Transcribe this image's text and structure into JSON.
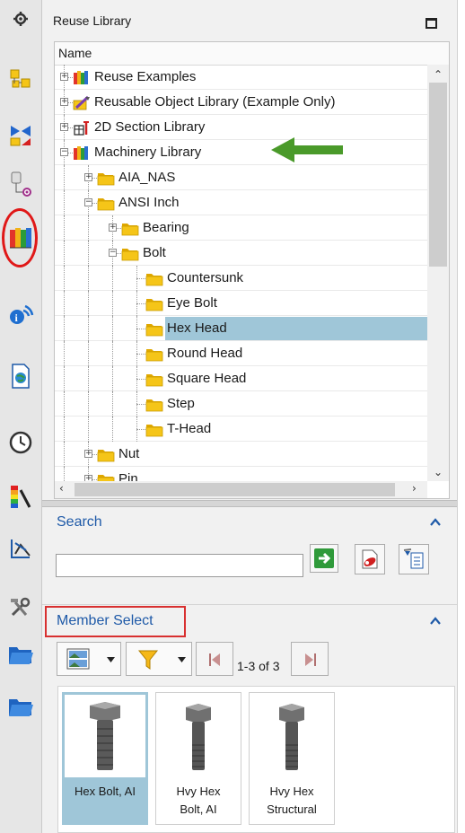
{
  "panel": {
    "title": "Reuse Library"
  },
  "tree": {
    "column_header": "Name",
    "rows": [
      {
        "label": "Reuse Examples",
        "icon": "library-books-icon"
      },
      {
        "label": "Reusable Object Library (Example Only)",
        "icon": "object-library-icon"
      },
      {
        "label": "2D Section Library",
        "icon": "section-library-icon"
      },
      {
        "label": "Machinery Library",
        "icon": "library-books-icon"
      },
      {
        "label": "AIA_NAS",
        "icon": "folder-icon"
      },
      {
        "label": "ANSI Inch",
        "icon": "folder-icon"
      },
      {
        "label": "Bearing",
        "icon": "folder-icon"
      },
      {
        "label": "Bolt",
        "icon": "folder-icon"
      },
      {
        "label": "Countersunk",
        "icon": "folder-icon"
      },
      {
        "label": "Eye Bolt",
        "icon": "folder-icon"
      },
      {
        "label": "Hex Head",
        "icon": "folder-icon",
        "selected": true
      },
      {
        "label": "Round Head",
        "icon": "folder-icon"
      },
      {
        "label": "Square Head",
        "icon": "folder-icon"
      },
      {
        "label": "Step",
        "icon": "folder-icon"
      },
      {
        "label": "T-Head",
        "icon": "folder-icon"
      },
      {
        "label": "Nut",
        "icon": "folder-icon"
      },
      {
        "label": "Pin",
        "icon": "folder-icon"
      }
    ]
  },
  "search": {
    "label": "Search",
    "value": "",
    "buttons": [
      "go-search-icon",
      "search-settings-icon",
      "search-results-icon"
    ]
  },
  "member_select": {
    "label": "Member Select",
    "count": "1-3 of 3",
    "items": [
      {
        "line1": "Hex Bolt, AI",
        "line2": "",
        "selected": true
      },
      {
        "line1": "Hvy Hex",
        "line2": "Bolt, AI",
        "selected": false
      },
      {
        "line1": "Hvy Hex",
        "line2": "Structural",
        "selected": false
      }
    ]
  },
  "left_bar": {
    "icons": [
      "settings-gear-icon",
      "assembly-navigator-icon",
      "constraint-navigator-icon",
      "part-navigator-icon",
      "reuse-library-icon",
      "hd3d-tools-icon",
      "web-browser-icon",
      "history-icon",
      "visualization-icon",
      "analysis-icon",
      "tools-icon",
      "folder-icon-1",
      "folder-icon-2"
    ],
    "highlighted": "reuse-library-icon"
  },
  "colors": {
    "selection": "#9fc6d8",
    "section_label": "#1f5aa8",
    "annotation_red": "#e01818",
    "annotation_arrow": "#4a9a2a",
    "folder": "#f3c21b"
  }
}
